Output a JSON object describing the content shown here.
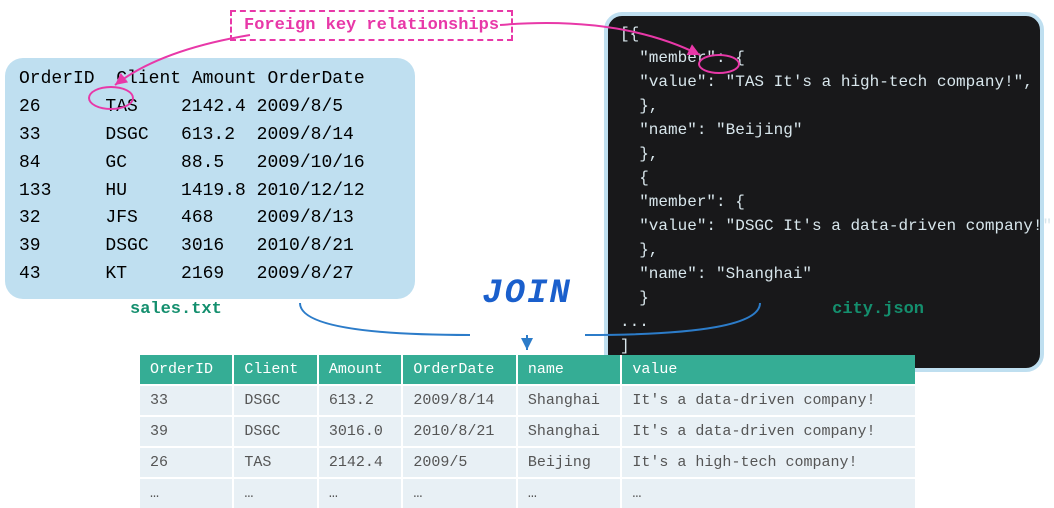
{
  "fk_label": "Foreign key relationships",
  "join_label": "JOIN",
  "sales_filename": "sales.txt",
  "json_filename": "city.json",
  "sales": {
    "headers": [
      "OrderID",
      "Client",
      "Amount",
      "OrderDate"
    ],
    "rows": [
      {
        "OrderID": "26",
        "Client": "TAS",
        "Amount": "2142.4",
        "OrderDate": "2009/8/5"
      },
      {
        "OrderID": "33",
        "Client": "DSGC",
        "Amount": "613.2",
        "OrderDate": "2009/8/14"
      },
      {
        "OrderID": "84",
        "Client": "GC",
        "Amount": "88.5",
        "OrderDate": "2009/10/16"
      },
      {
        "OrderID": "133",
        "Client": "HU",
        "Amount": "1419.8",
        "OrderDate": "2010/12/12"
      },
      {
        "OrderID": "32",
        "Client": "JFS",
        "Amount": "468",
        "OrderDate": "2009/8/13"
      },
      {
        "OrderID": "39",
        "Client": "DSGC",
        "Amount": "3016",
        "OrderDate": "2010/8/21"
      },
      {
        "OrderID": "43",
        "Client": "KT",
        "Amount": "2169",
        "OrderDate": "2009/8/27"
      }
    ]
  },
  "json_lines": [
    "[{",
    "  \"member\": {",
    "  \"value\": \"TAS It's a high-tech company!\",",
    "  },",
    "  \"name\": \"Beijing\"",
    "  },",
    "  {",
    "  \"member\": {",
    "  \"value\": \"DSGC It's a data-driven company!\"",
    "  },",
    "  \"name\": \"Shanghai\"",
    "  }",
    "...",
    "]"
  ],
  "result": {
    "headers": [
      "OrderID",
      "Client",
      "Amount",
      "OrderDate",
      "name",
      "value"
    ],
    "rows": [
      {
        "OrderID": "33",
        "Client": "DSGC",
        "Amount": "613.2",
        "OrderDate": "2009/8/14",
        "name": "Shanghai",
        "value": "It's a data-driven company!"
      },
      {
        "OrderID": "39",
        "Client": "DSGC",
        "Amount": "3016.0",
        "OrderDate": "2010/8/21",
        "name": "Shanghai",
        "value": "It's a data-driven company!"
      },
      {
        "OrderID": "26",
        "Client": "TAS",
        "Amount": "2142.4",
        "OrderDate": "2009/5",
        "name": "Beijing",
        "value": "It's a high-tech company!"
      },
      {
        "OrderID": "…",
        "Client": "…",
        "Amount": "…",
        "OrderDate": "…",
        "name": "…",
        "value": "…"
      }
    ]
  },
  "chart_data": {
    "type": "table",
    "description": "Diagram showing JOIN operation between sales.txt (tabular text file) and city.json (JSON) via foreign key Client <-> first token of member.value",
    "left_source": "sales.txt",
    "right_source": "city.json",
    "foreign_key": {
      "left_column": "Client",
      "right_field": "member.value (prefix token)"
    },
    "result_columns": [
      "OrderID",
      "Client",
      "Amount",
      "OrderDate",
      "name",
      "value"
    ]
  }
}
